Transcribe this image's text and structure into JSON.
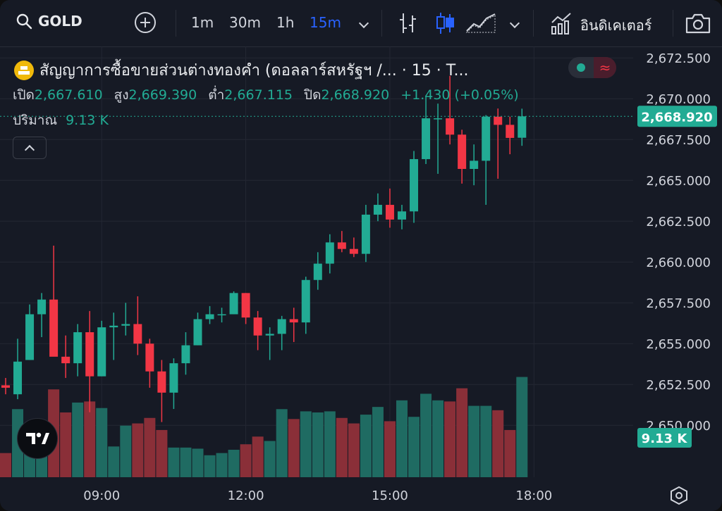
{
  "toolbar": {
    "symbol": "GOLD",
    "intervals": [
      "1m",
      "30m",
      "1h",
      "15m"
    ],
    "active_interval": "15m",
    "indicators_label": "อินดิเคเตอร์",
    "icons": [
      "search-icon",
      "add-symbol-icon",
      "chevron-down-icon",
      "bar-chart-type-icon",
      "candles-icon",
      "area-chart-icon",
      "chevron-down-icon",
      "indicators-icon",
      "camera-icon"
    ]
  },
  "legend": {
    "title": "สัญญาการซื้อขายส่วนต่างทองคำ (ดอลลาร์สหรัฐฯ /...  · 15 · T...",
    "open_label": "เปิด",
    "open": "2,667.610",
    "high_label": "สูง",
    "high": "2,669.390",
    "low_label": "ต่ำ",
    "low": "2,667.115",
    "close_label": "ปิด",
    "close": "2,668.920",
    "change": "+1.430 (+0.05%)",
    "volume_label": "ปริมาณ",
    "volume": "9.13 K"
  },
  "colors": {
    "up": "#22ab94",
    "down": "#f23645",
    "bg": "#161a25",
    "grid": "#232733",
    "last_price": "#22ab94"
  },
  "chart_data": {
    "type": "candlestick",
    "symbol": "GOLD",
    "interval": "15m",
    "price_axis": [
      "2,672.500",
      "2,670.000",
      "2,667.500",
      "2,665.000",
      "2,662.500",
      "2,660.000",
      "2,657.500",
      "2,655.000",
      "2,652.500",
      "2,650.000"
    ],
    "price_range": [
      2649.2,
      2673.2
    ],
    "time_ticks": [
      {
        "label": "09:00",
        "index": 8
      },
      {
        "label": "12:00",
        "index": 20
      },
      {
        "label": "15:00",
        "index": 32
      },
      {
        "label": "18:00",
        "index": 44
      }
    ],
    "last_price": "2,668.920",
    "last_volume": "9.13 K",
    "candles": [
      {
        "o": 2652.45,
        "h": 2652.9,
        "l": 2651.9,
        "c": 2652.3
      },
      {
        "o": 2651.9,
        "h": 2655.3,
        "l": 2651.6,
        "c": 2653.9
      },
      {
        "o": 2654.0,
        "h": 2657.4,
        "l": 2654.0,
        "c": 2656.8
      },
      {
        "o": 2656.8,
        "h": 2658.1,
        "l": 2655.4,
        "c": 2657.7
      },
      {
        "o": 2657.7,
        "h": 2661.0,
        "l": 2655.0,
        "c": 2654.2
      },
      {
        "o": 2654.2,
        "h": 2655.5,
        "l": 2652.9,
        "c": 2653.8
      },
      {
        "o": 2653.8,
        "h": 2656.2,
        "l": 2653.0,
        "c": 2655.7
      },
      {
        "o": 2655.7,
        "h": 2657.0,
        "l": 2650.8,
        "c": 2653.0
      },
      {
        "o": 2653.0,
        "h": 2656.4,
        "l": 2653.0,
        "c": 2656.0
      },
      {
        "o": 2656.0,
        "h": 2656.9,
        "l": 2654.0,
        "c": 2656.1
      },
      {
        "o": 2656.1,
        "h": 2657.5,
        "l": 2655.5,
        "c": 2656.2
      },
      {
        "o": 2656.2,
        "h": 2657.9,
        "l": 2654.3,
        "c": 2655.0
      },
      {
        "o": 2655.0,
        "h": 2655.3,
        "l": 2652.3,
        "c": 2653.3
      },
      {
        "o": 2653.3,
        "h": 2654.0,
        "l": 2650.2,
        "c": 2652.0
      },
      {
        "o": 2652.0,
        "h": 2654.1,
        "l": 2651.0,
        "c": 2653.8
      },
      {
        "o": 2653.8,
        "h": 2655.7,
        "l": 2653.1,
        "c": 2654.9
      },
      {
        "o": 2654.9,
        "h": 2656.9,
        "l": 2654.9,
        "c": 2656.5
      },
      {
        "o": 2656.5,
        "h": 2657.3,
        "l": 2656.2,
        "c": 2656.8
      },
      {
        "o": 2656.8,
        "h": 2657.2,
        "l": 2656.3,
        "c": 2656.8
      },
      {
        "o": 2656.8,
        "h": 2658.2,
        "l": 2656.8,
        "c": 2658.1
      },
      {
        "o": 2658.1,
        "h": 2658.1,
        "l": 2656.2,
        "c": 2656.6
      },
      {
        "o": 2656.6,
        "h": 2657.0,
        "l": 2654.6,
        "c": 2655.5
      },
      {
        "o": 2655.5,
        "h": 2656.0,
        "l": 2654.0,
        "c": 2655.6
      },
      {
        "o": 2655.6,
        "h": 2656.7,
        "l": 2654.6,
        "c": 2656.5
      },
      {
        "o": 2656.5,
        "h": 2657.2,
        "l": 2655.1,
        "c": 2656.3
      },
      {
        "o": 2656.3,
        "h": 2659.1,
        "l": 2655.6,
        "c": 2658.9
      },
      {
        "o": 2658.9,
        "h": 2660.6,
        "l": 2658.3,
        "c": 2659.9
      },
      {
        "o": 2659.9,
        "h": 2661.7,
        "l": 2659.3,
        "c": 2661.2
      },
      {
        "o": 2661.2,
        "h": 2661.9,
        "l": 2660.6,
        "c": 2660.8
      },
      {
        "o": 2660.8,
        "h": 2661.5,
        "l": 2660.3,
        "c": 2660.5
      },
      {
        "o": 2660.5,
        "h": 2663.5,
        "l": 2660.0,
        "c": 2662.9
      },
      {
        "o": 2662.9,
        "h": 2664.2,
        "l": 2662.5,
        "c": 2663.5
      },
      {
        "o": 2663.5,
        "h": 2664.5,
        "l": 2662.1,
        "c": 2662.6
      },
      {
        "o": 2662.6,
        "h": 2663.5,
        "l": 2662.0,
        "c": 2663.1
      },
      {
        "o": 2663.1,
        "h": 2666.8,
        "l": 2662.4,
        "c": 2666.3
      },
      {
        "o": 2666.3,
        "h": 2670.2,
        "l": 2666.0,
        "c": 2668.8
      },
      {
        "o": 2668.8,
        "h": 2669.7,
        "l": 2665.4,
        "c": 2668.8
      },
      {
        "o": 2668.8,
        "h": 2671.4,
        "l": 2667.2,
        "c": 2667.8
      },
      {
        "o": 2667.8,
        "h": 2668.1,
        "l": 2664.8,
        "c": 2665.7
      },
      {
        "o": 2665.7,
        "h": 2667.2,
        "l": 2664.7,
        "c": 2666.2
      },
      {
        "o": 2666.2,
        "h": 2669.0,
        "l": 2663.5,
        "c": 2668.9
      },
      {
        "o": 2668.9,
        "h": 2669.4,
        "l": 2665.1,
        "c": 2668.4
      },
      {
        "o": 2668.4,
        "h": 2668.9,
        "l": 2666.6,
        "c": 2667.6
      },
      {
        "o": 2667.61,
        "h": 2669.39,
        "l": 2667.115,
        "c": 2668.92
      }
    ],
    "volumes": [
      2.2,
      6.2,
      4.4,
      4.5,
      8.0,
      5.9,
      6.8,
      6.9,
      6.3,
      2.8,
      4.7,
      4.9,
      5.4,
      4.3,
      2.7,
      2.7,
      2.6,
      2.0,
      2.2,
      2.5,
      3.0,
      3.7,
      3.3,
      6.2,
      5.3,
      6.0,
      5.9,
      6.0,
      5.4,
      4.9,
      5.7,
      6.4,
      5.1,
      7.0,
      5.5,
      7.6,
      7.0,
      6.9,
      8.1,
      6.5,
      6.5,
      6.1,
      4.3,
      9.13
    ],
    "volume_scale_k": [
      0,
      10
    ]
  }
}
